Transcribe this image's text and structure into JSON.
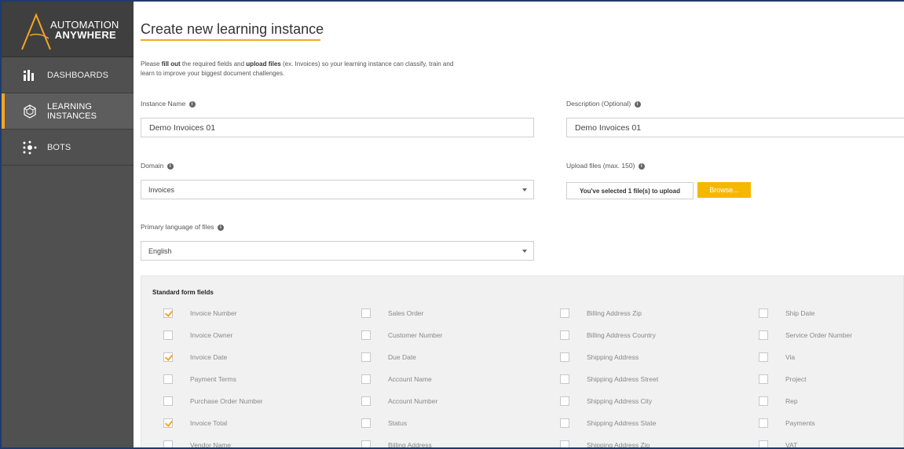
{
  "logo": {
    "line1": "AUTOMATION",
    "line2": "ANYWHERE"
  },
  "sidebar": {
    "items": [
      {
        "label": "DASHBOARDS",
        "icon": "bar-chart-icon",
        "active": false
      },
      {
        "label": "LEARNING INSTANCES",
        "icon": "learning-cube-icon",
        "active": true
      },
      {
        "label": "BOTS",
        "icon": "bots-icon",
        "active": false
      }
    ]
  },
  "page": {
    "title": "Create new learning instance",
    "intro_pre": "Please ",
    "intro_b1": "fill out",
    "intro_mid": " the required fields and ",
    "intro_b2": "upload files",
    "intro_post": " (ex. Invoices) so your learning instance can classify, train and",
    "intro_line2": "learn to improve your biggest document challenges."
  },
  "form": {
    "instance_name_label": "Instance Name",
    "instance_name_value": "Demo Invoices 01",
    "description_label": "Description (Optional)",
    "description_value": "Demo Invoices 01",
    "domain_label": "Domain",
    "domain_value": "Invoices",
    "upload_label": "Upload files (max. 150)",
    "upload_status": "You've selected 1 file(s) to upload",
    "browse_label": "Browse...",
    "language_label": "Primary language of files",
    "language_value": "English"
  },
  "fields": {
    "title": "Standard form fields",
    "columns": [
      [
        {
          "label": "Invoice Number",
          "checked": true
        },
        {
          "label": "Invoice Owner",
          "checked": false
        },
        {
          "label": "Invoice Date",
          "checked": true
        },
        {
          "label": "Payment Terms",
          "checked": false
        },
        {
          "label": "Purchase Order Number",
          "checked": false
        },
        {
          "label": "Invoice Total",
          "checked": true
        },
        {
          "label": "Vendor Name",
          "checked": false
        }
      ],
      [
        {
          "label": "Sales Order",
          "checked": false
        },
        {
          "label": "Customer Number",
          "checked": false
        },
        {
          "label": "Due Date",
          "checked": false
        },
        {
          "label": "Account Name",
          "checked": false
        },
        {
          "label": "Account Number",
          "checked": false
        },
        {
          "label": "Status",
          "checked": false
        },
        {
          "label": "Billing Address",
          "checked": false
        }
      ],
      [
        {
          "label": "Billing Address Zip",
          "checked": false
        },
        {
          "label": "Billing Address Country",
          "checked": false
        },
        {
          "label": "Shipping Address",
          "checked": false
        },
        {
          "label": "Shipping Address Street",
          "checked": false
        },
        {
          "label": "Shipping Address City",
          "checked": false
        },
        {
          "label": "Shipping Address State",
          "checked": false
        },
        {
          "label": "Shipping Address Zip",
          "checked": false
        }
      ],
      [
        {
          "label": "Ship Date",
          "checked": false
        },
        {
          "label": "Service Order Number",
          "checked": false
        },
        {
          "label": "Via",
          "checked": false
        },
        {
          "label": "Project",
          "checked": false
        },
        {
          "label": "Rep",
          "checked": false
        },
        {
          "label": "Payments",
          "checked": false
        },
        {
          "label": "VAT",
          "checked": false
        }
      ]
    ]
  },
  "colors": {
    "accent": "#f5a623",
    "sidebar": "#505050",
    "browse": "#f5b800"
  }
}
